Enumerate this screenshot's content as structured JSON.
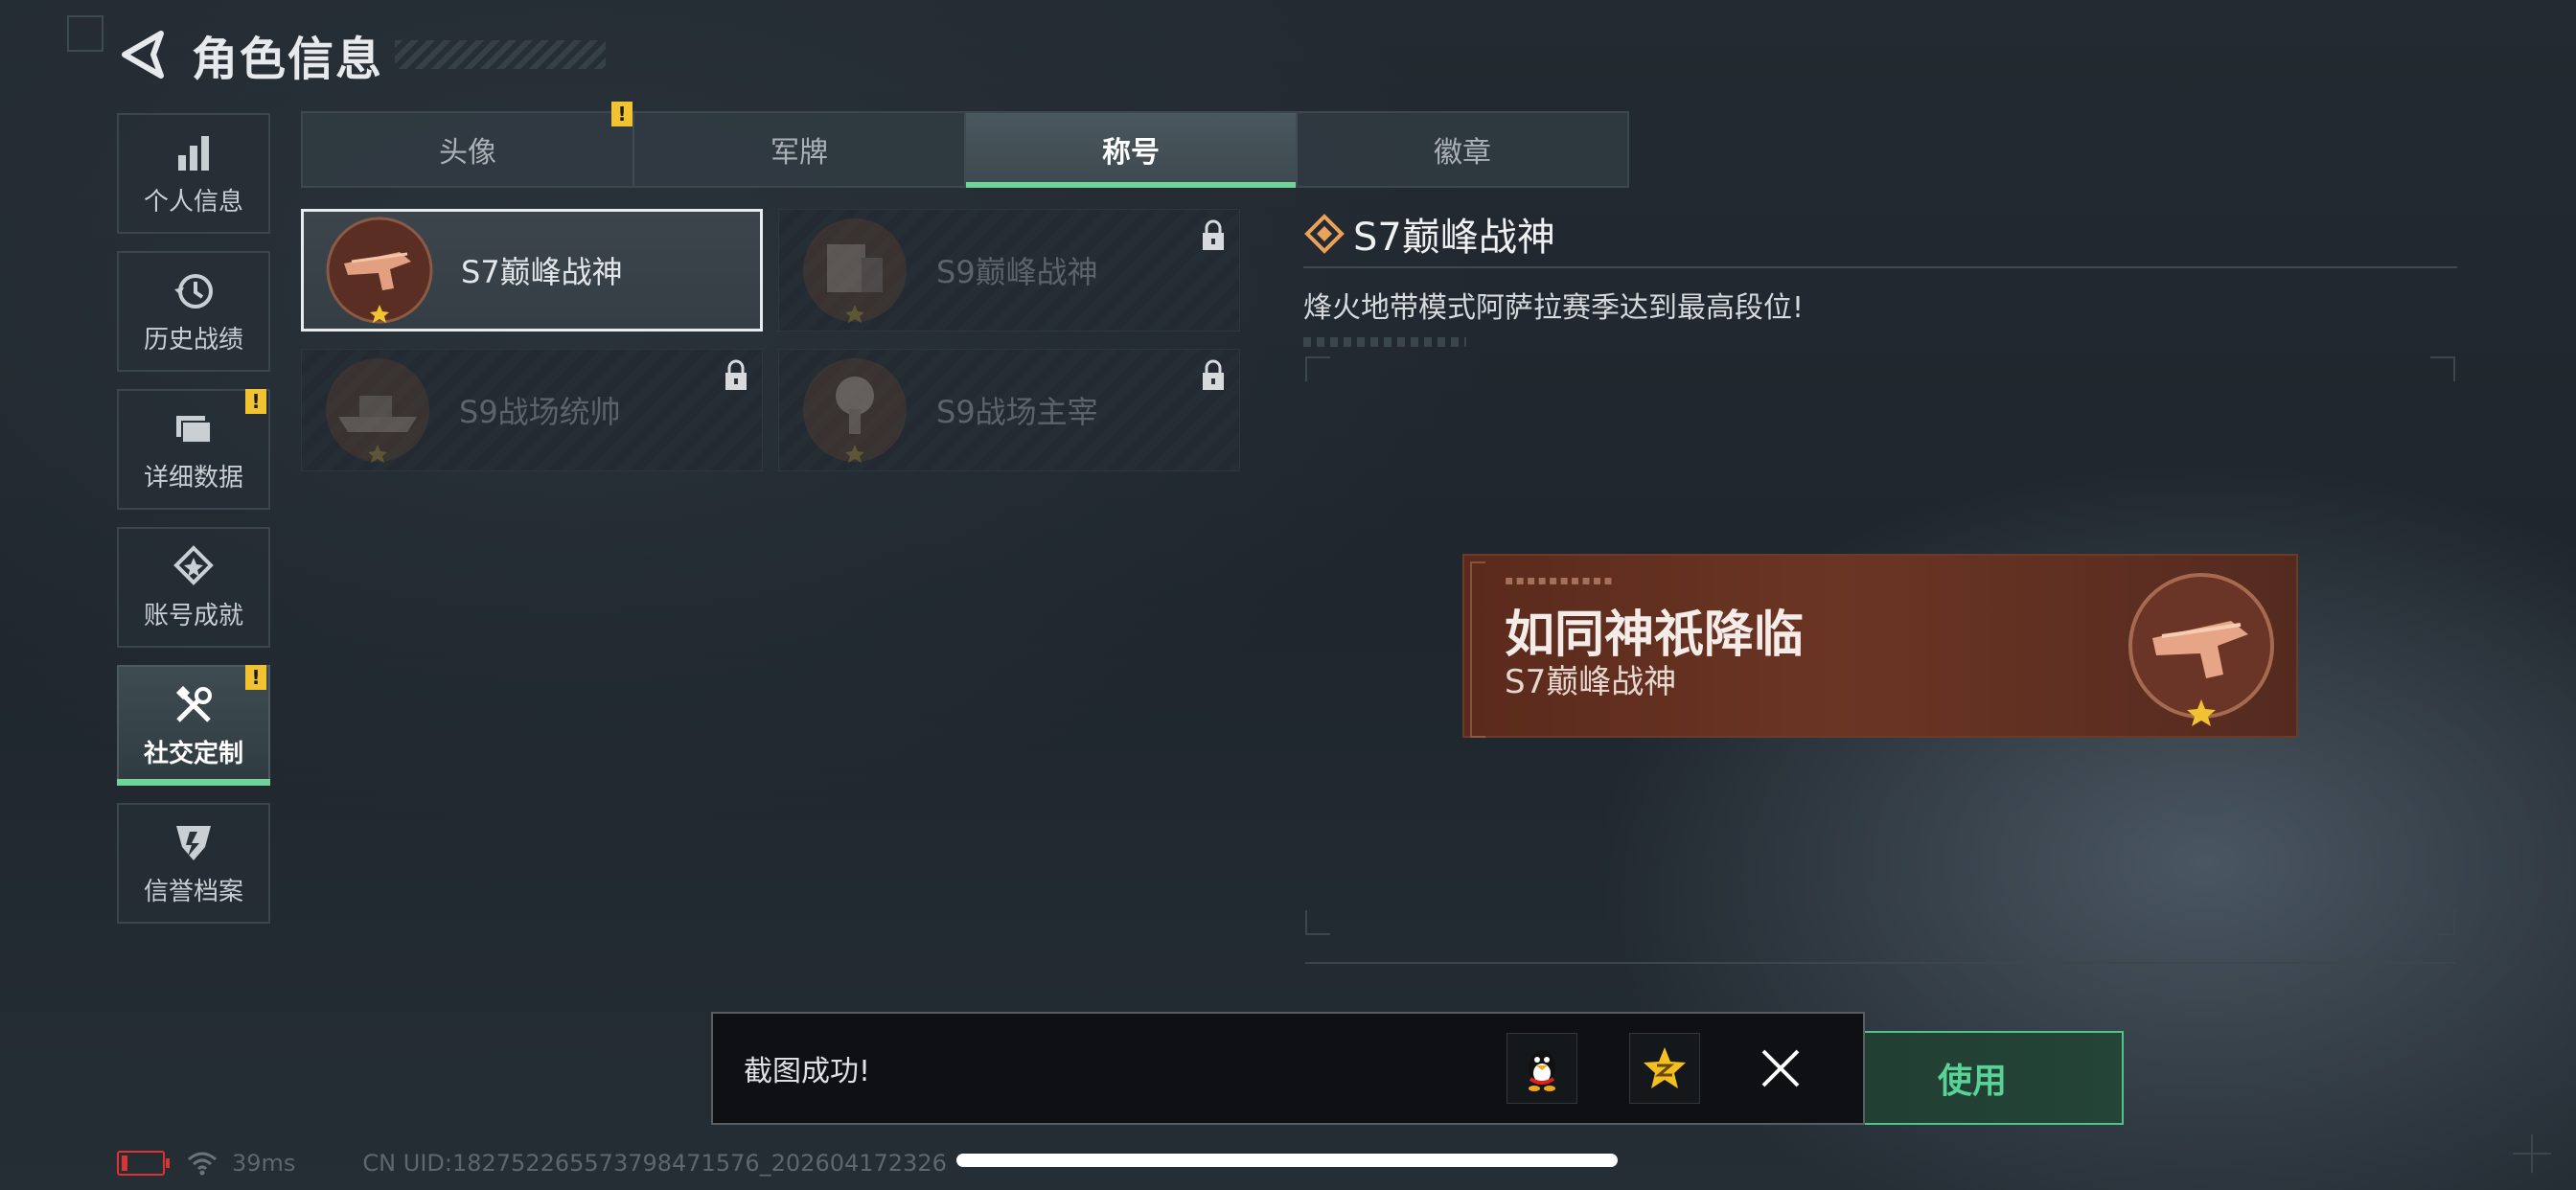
{
  "header": {
    "title": "角色信息",
    "back_icon": "back-arrow-icon"
  },
  "sidebar": {
    "items": [
      {
        "label": "个人信息",
        "icon": "bar-chart-icon",
        "warn": ""
      },
      {
        "label": "历史战绩",
        "icon": "history-clock-icon",
        "warn": ""
      },
      {
        "label": "详细数据",
        "icon": "folder-icon",
        "warn": "!"
      },
      {
        "label": "账号成就",
        "icon": "medal-icon",
        "warn": ""
      },
      {
        "label": "社交定制",
        "icon": "tools-icon",
        "warn": "!",
        "active": true
      },
      {
        "label": "信誉档案",
        "icon": "credit-shield-icon",
        "warn": ""
      }
    ]
  },
  "tabs": [
    {
      "label": "头像",
      "warn": "!"
    },
    {
      "label": "军牌",
      "warn": ""
    },
    {
      "label": "称号",
      "warn": "",
      "active": true
    },
    {
      "label": "徽章",
      "warn": ""
    }
  ],
  "cards": [
    {
      "name": "S7巅峰战神",
      "locked": false,
      "selected": true,
      "icon": "gun-medal-icon"
    },
    {
      "name": "S9巅峰战神",
      "locked": true,
      "selected": false,
      "icon": "building-medal-icon"
    },
    {
      "name": "S9战场统帅",
      "locked": true,
      "selected": false,
      "icon": "ship-medal-icon"
    },
    {
      "name": "S9战场主宰",
      "locked": true,
      "selected": false,
      "icon": "explosion-medal-icon"
    }
  ],
  "detail": {
    "title": "S7巅峰战神",
    "description": "烽火地带模式阿萨拉赛季达到最高段位!",
    "banner_main": "如同神祇降临",
    "banner_sub": "S7巅峰战神"
  },
  "use_button": {
    "label": "使用"
  },
  "toast": {
    "text": "截图成功!",
    "share1_icon": "qq-penguin-icon",
    "share2_icon": "qzone-star-icon",
    "close_icon": "close-icon"
  },
  "status": {
    "ping": "39ms",
    "uid": "CN UID:1827522655737984715​76_202604172326"
  },
  "colors": {
    "accent": "#6fd49a",
    "warn": "#f2c330",
    "banner": "#6b3524"
  }
}
